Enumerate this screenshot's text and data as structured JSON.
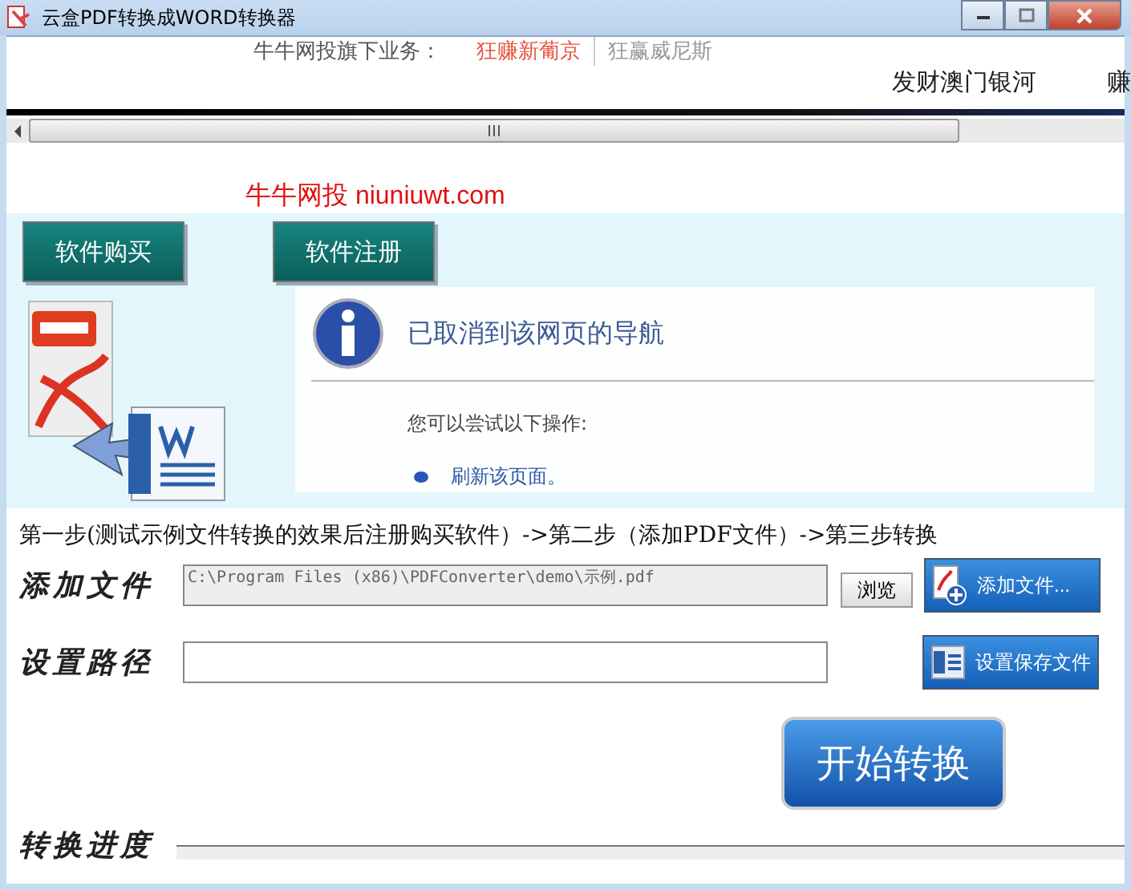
{
  "window": {
    "title": "云盒PDF转换成WORD转换器"
  },
  "banner": {
    "label": "牛牛网投旗下业务：",
    "links": [
      {
        "text": "狂赚新葡京",
        "selected": true
      },
      {
        "text": "狂赢威尼斯",
        "selected": false
      }
    ],
    "ads": [
      "发财澳门银河",
      "赚"
    ],
    "site": "牛牛网投 niuniuwt.com"
  },
  "top_buttons": [
    "软件购买",
    "软件注册"
  ],
  "error_page": {
    "title": "已取消到该网页的导航",
    "hint": "您可以尝试以下操作:",
    "actions": [
      "刷新该页面。"
    ]
  },
  "steps": "第一步(测试示例文件转换的效果后注册购买软件）->第二步（添加PDF文件）->第三步转换",
  "add_file": {
    "label": "添加文件",
    "value": "C:\\Program Files (x86)\\PDFConverter\\demo\\示例.pdf",
    "disabled": true,
    "browse": "浏览",
    "button": "添加文件..."
  },
  "save_path": {
    "label": "设置路径",
    "disabled": false,
    "button": "设置保存文件"
  },
  "start_button": "开始转换",
  "progress": {
    "label": "转换进度",
    "level": 0
  }
}
